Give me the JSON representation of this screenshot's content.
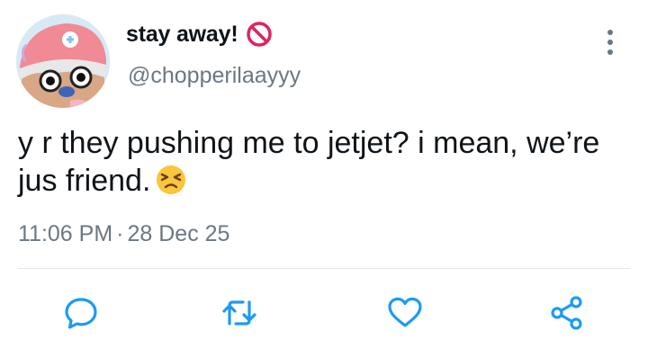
{
  "tweet": {
    "display_name": "stay away!",
    "handle": "@chopperilaayyy",
    "text": "y r they pushing me to jetjet? i mean, we’re jus friend.",
    "time": "11:06 PM",
    "separator": "·",
    "date": "28 Dec 25",
    "name_icon": "prohibited-icon",
    "text_emoji": "persevering-face-emoji",
    "colors": {
      "text": "#0f1419",
      "secondary": "#6b7784",
      "action_icons": "#1d9bf0",
      "prohibited": "#e0245e",
      "divider": "#e1e8ed"
    }
  },
  "actions": [
    {
      "name": "reply",
      "icon": "chat-bubble-icon"
    },
    {
      "name": "retweet",
      "icon": "retweet-icon"
    },
    {
      "name": "like",
      "icon": "heart-icon"
    },
    {
      "name": "share",
      "icon": "share-icon"
    }
  ]
}
